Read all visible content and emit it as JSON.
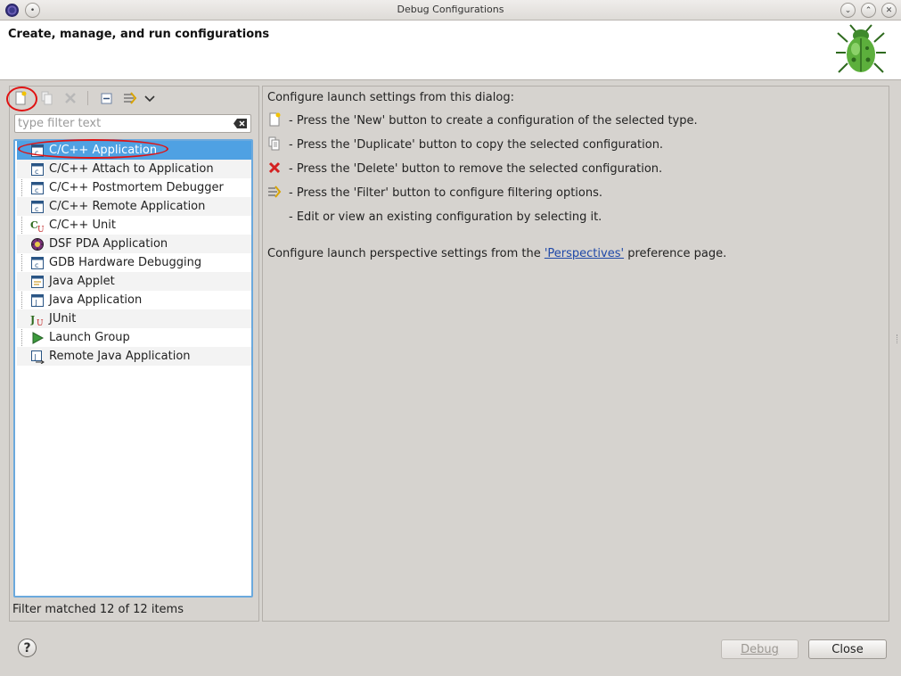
{
  "window": {
    "title": "Debug Configurations"
  },
  "header": {
    "title": "Create, manage, and run configurations"
  },
  "filter": {
    "placeholder": "type filter text",
    "value": ""
  },
  "tree": {
    "items": [
      {
        "label": "C/C++ Application",
        "icon": "c-app-icon",
        "selected": true
      },
      {
        "label": "C/C++ Attach to Application",
        "icon": "c-app-icon"
      },
      {
        "label": "C/C++ Postmortem Debugger",
        "icon": "c-app-icon"
      },
      {
        "label": "C/C++ Remote Application",
        "icon": "c-app-icon"
      },
      {
        "label": "C/C++ Unit",
        "icon": "c-unit-icon"
      },
      {
        "label": "DSF PDA Application",
        "icon": "pda-icon"
      },
      {
        "label": "GDB Hardware Debugging",
        "icon": "c-app-icon"
      },
      {
        "label": "Java Applet",
        "icon": "applet-icon"
      },
      {
        "label": "Java Application",
        "icon": "java-app-icon"
      },
      {
        "label": "JUnit",
        "icon": "junit-icon"
      },
      {
        "label": "Launch Group",
        "icon": "launch-group-icon"
      },
      {
        "label": "Remote Java Application",
        "icon": "remote-java-icon"
      }
    ]
  },
  "status": {
    "text": "Filter matched 12 of 12 items"
  },
  "info": {
    "intro": "Configure launch settings from this dialog:",
    "new_line": "- Press the 'New' button to create a configuration of the selected type.",
    "duplicate_line": "- Press the 'Duplicate' button to copy the selected configuration.",
    "delete_line": "- Press the 'Delete' button to remove the selected configuration.",
    "filter_line": "- Press the 'Filter' button to configure filtering options.",
    "edit_line": "- Edit or view an existing configuration by selecting it.",
    "perspective_prefix": "Configure launch perspective settings from the ",
    "perspective_link": "'Perspectives'",
    "perspective_suffix": " preference page."
  },
  "buttons": {
    "help": "?",
    "debug": "Debug",
    "close": "Close"
  },
  "colors": {
    "selection": "#4fa1e3",
    "annotation": "#e01212",
    "link": "#1f48a8"
  }
}
